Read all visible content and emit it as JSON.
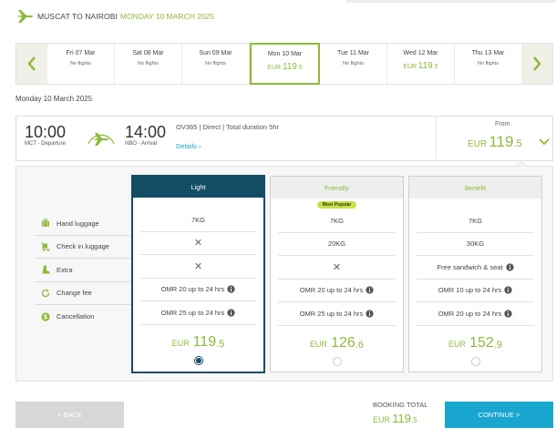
{
  "header": {
    "route": "MUSCAT TO NAIROBI",
    "date": "MONDAY 10 MARCH 2025"
  },
  "dates": [
    {
      "name": "Fri 07 Mar",
      "sub": "No flights",
      "selected": false
    },
    {
      "name": "Sat 08 Mar",
      "sub": "No flights",
      "selected": false
    },
    {
      "name": "Sun 09 Mar",
      "sub": "No flights",
      "selected": false
    },
    {
      "name": "Mon 10 Mar",
      "sub": "",
      "currency": "EUR",
      "amount": "119",
      "decimal": ".5",
      "selected": true
    },
    {
      "name": "Tue 11 Mar",
      "sub": "No flights",
      "selected": false
    },
    {
      "name": "Wed 12 Mar",
      "sub": "",
      "currency": "EUR",
      "amount": "119",
      "decimal": ".5",
      "selected": false
    },
    {
      "name": "Thu 13 Mar",
      "sub": "No flights",
      "selected": false
    }
  ],
  "date_label": "Monday 10 March 2025",
  "flight": {
    "dep_time": "10:00",
    "dep_code": "MCT - Departure",
    "arr_time": "14:00",
    "arr_code": "NBO - Arrival",
    "info": "OV365 | Direct | Total duration 5hr",
    "details": "Details",
    "from_label": "From",
    "currency": "EUR",
    "amount": "119",
    "decimal": ".5"
  },
  "features": [
    {
      "label": "Hand luggage",
      "icon": "suitcase-icon"
    },
    {
      "label": "Check in luggage",
      "icon": "luggage-trolley-icon"
    },
    {
      "label": "Extra",
      "icon": "boot-icon"
    },
    {
      "label": "Change fee",
      "icon": "refresh-icon"
    },
    {
      "label": "Cancellation",
      "icon": "dollar-circle-icon"
    }
  ],
  "fares": [
    {
      "name": "Light",
      "badge": "",
      "cells": [
        {
          "text": "7KG"
        },
        {
          "text": "✕",
          "cross": true
        },
        {
          "text": "✕",
          "cross": true
        },
        {
          "text": "OMR 20 up to 24 hrs",
          "info": true
        },
        {
          "text": "OMR 25 up to 24 hrs",
          "info": true
        }
      ],
      "currency": "EUR",
      "amount": "119",
      "decimal": ".5",
      "selected": true
    },
    {
      "name": "Friendly",
      "badge": "Most Popular",
      "cells": [
        {
          "text": "7KG"
        },
        {
          "text": "20KG"
        },
        {
          "text": "✕",
          "cross": true
        },
        {
          "text": "OMR 20 up to 24 hrs",
          "info": true
        },
        {
          "text": "OMR 25 up to 24 hrs",
          "info": true
        }
      ],
      "currency": "EUR",
      "amount": "126",
      "decimal": ".6",
      "selected": false
    },
    {
      "name": "Benefit",
      "badge": "",
      "cells": [
        {
          "text": "7KG"
        },
        {
          "text": "30KG"
        },
        {
          "text": "Free sandwich & seat",
          "info": true
        },
        {
          "text": "OMR 10 up to 24 hrs",
          "info": true
        },
        {
          "text": "OMR 20 up to 24 hrs",
          "info": true
        }
      ],
      "currency": "EUR",
      "amount": "152",
      "decimal": ".9",
      "selected": false
    }
  ],
  "footer": {
    "back": "< BACK",
    "total_label": "BOOKING TOTAL",
    "currency": "EUR",
    "amount": "119",
    "decimal": ".5",
    "continue": "CONTINUE >"
  },
  "colors": {
    "accent_green": "#8dbb3c",
    "navy": "#134d63",
    "cyan": "#19a6cf"
  }
}
